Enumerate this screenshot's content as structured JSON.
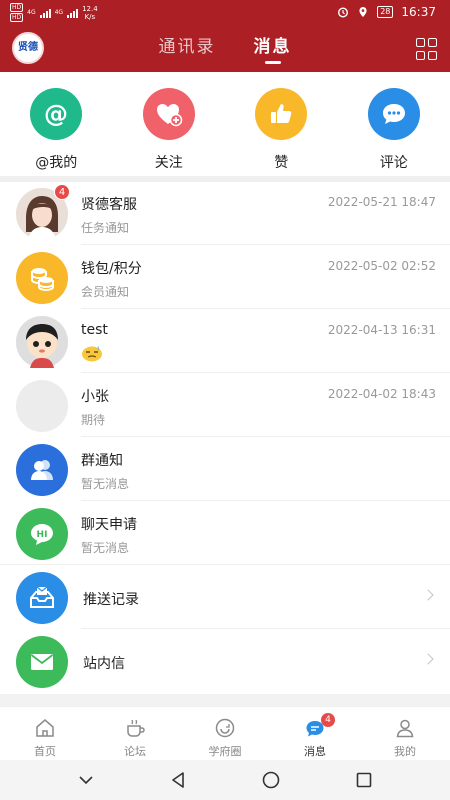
{
  "status_bar": {
    "sim1": "HD",
    "sim2": "HD",
    "network1": "4G",
    "network2": "4G",
    "speed": "12.4",
    "speed_unit": "K/s",
    "battery": "28",
    "time": "16:37"
  },
  "header": {
    "logo_text": "贤德",
    "tabs": [
      {
        "label": "通讯录",
        "active": false
      },
      {
        "label": "消息",
        "active": true
      }
    ],
    "menu_icon": "grid-icon"
  },
  "quick_actions": [
    {
      "label": "@我的",
      "icon": "at-icon",
      "color": "#1fb98c"
    },
    {
      "label": "关注",
      "icon": "heart-plus-icon",
      "color": "#f0616a"
    },
    {
      "label": "赞",
      "icon": "thumbs-up-icon",
      "color": "#f9b72a"
    },
    {
      "label": "评论",
      "icon": "comment-icon",
      "color": "#2a8ee6"
    }
  ],
  "messages": [
    {
      "name": "贤德客服",
      "subtitle": "任务通知",
      "time": "2022-05-21 18:47",
      "badge": "4",
      "avatar": "girl-photo-avatar"
    },
    {
      "name": "钱包/积分",
      "subtitle": "会员通知",
      "time": "2022-05-02 02:52",
      "badge": "",
      "avatar": "coins-icon"
    },
    {
      "name": "test",
      "subtitle": "",
      "time": "2022-04-13 16:31",
      "badge": "",
      "avatar": "cartoon-boy-avatar",
      "emoji": "sweat-face-emoji"
    },
    {
      "name": "小张",
      "subtitle": "期待",
      "time": "2022-04-02 18:43",
      "badge": "",
      "avatar": "blank-avatar"
    },
    {
      "name": "群通知",
      "subtitle": "暂无消息",
      "time": "",
      "badge": "",
      "avatar": "group-icon"
    },
    {
      "name": "聊天申请",
      "subtitle": "暂无消息",
      "time": "",
      "badge": "",
      "avatar": "hi-bubble-icon"
    }
  ],
  "entries": [
    {
      "name": "推送记录",
      "icon": "inbox-mail-icon"
    },
    {
      "name": "站内信",
      "icon": "envelope-icon"
    }
  ],
  "bottom_nav": [
    {
      "label": "首页",
      "icon": "home-icon",
      "active": false
    },
    {
      "label": "论坛",
      "icon": "coffee-icon",
      "active": false
    },
    {
      "label": "学府圈",
      "icon": "refresh-circle-icon",
      "active": false
    },
    {
      "label": "消息",
      "icon": "chat-icon",
      "active": true,
      "badge": "4"
    },
    {
      "label": "我的",
      "icon": "person-icon",
      "active": false
    }
  ],
  "colors": {
    "header": "#ac1f24",
    "badge": "#e84a4a",
    "nav_active": "#2a8ee6"
  }
}
